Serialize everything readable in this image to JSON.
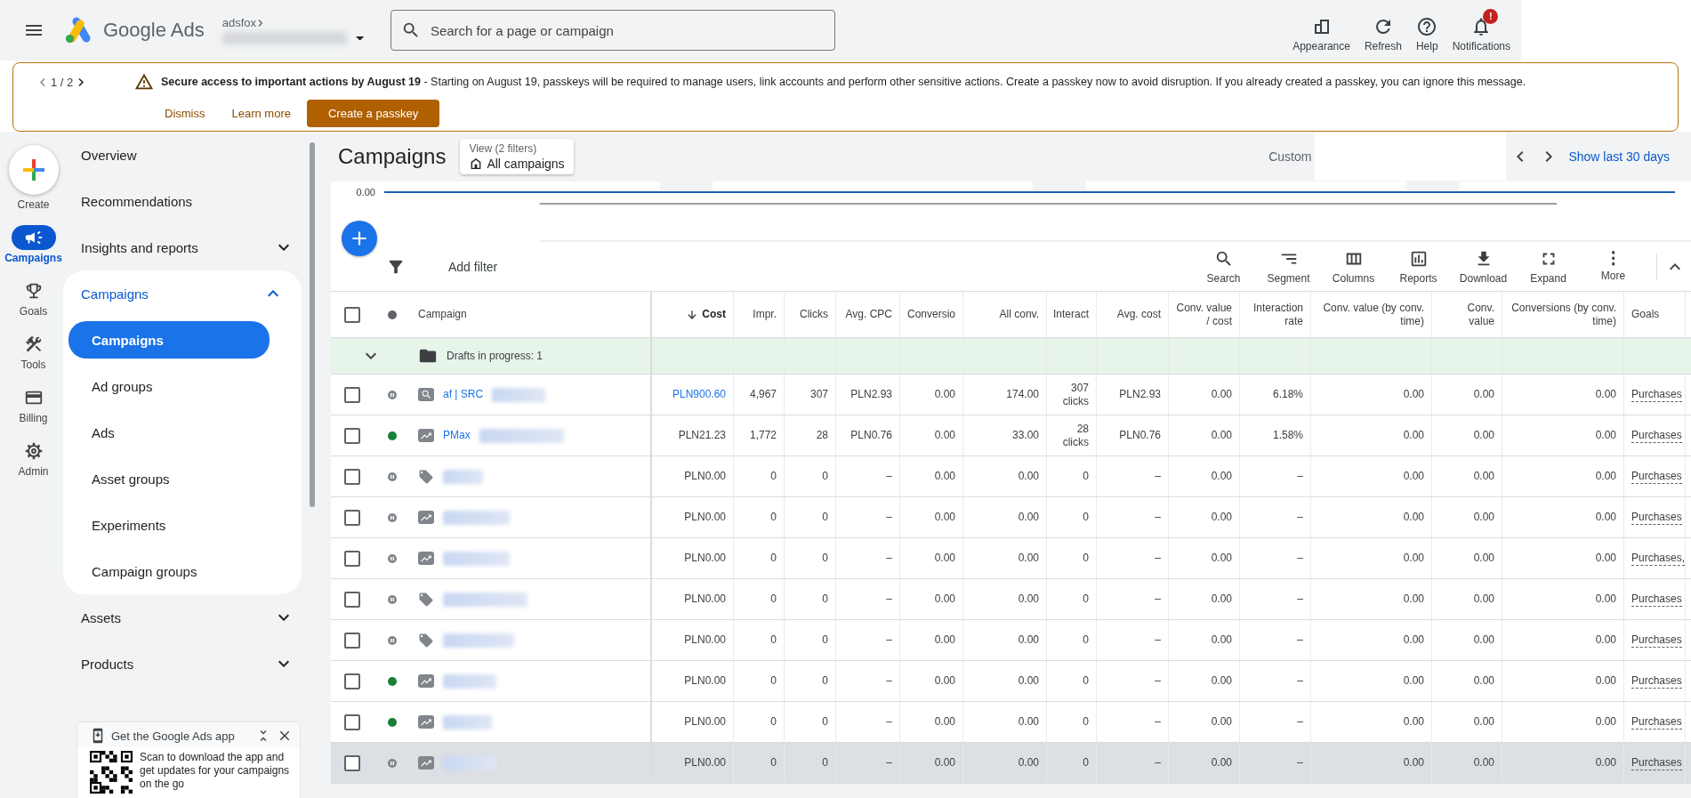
{
  "header": {
    "product": "Google Ads",
    "account": "adsfox",
    "search_placeholder": "Search for a page or campaign",
    "actions": [
      {
        "label": "Appearance",
        "kind": "appearance"
      },
      {
        "label": "Refresh",
        "kind": "refresh"
      },
      {
        "label": "Help",
        "kind": "help"
      },
      {
        "label": "Notifications",
        "kind": "notifications",
        "badge": "!"
      }
    ]
  },
  "banner": {
    "pager": "1 / 2",
    "message": "**Secure access to important actions by August 19** - Starting on August 19, passkeys will be required to manage users, link accounts and perform other sensitive actions. Create a passkey now to avoid disruption. If you already created a passkey, you can ignore this message.",
    "buttons": [
      {
        "label": "Dismiss",
        "kind": "text"
      },
      {
        "label": "Learn more",
        "kind": "text"
      },
      {
        "label": "Create a passkey",
        "kind": "primary"
      }
    ]
  },
  "rail": [
    {
      "label": "Create",
      "kind": "create",
      "selected": false
    },
    {
      "label": "Campaigns",
      "kind": "campaigns",
      "selected": true
    },
    {
      "label": "Goals",
      "kind": "goals",
      "selected": false
    },
    {
      "label": "Tools",
      "kind": "tools",
      "selected": false
    },
    {
      "label": "Billing",
      "kind": "billing",
      "selected": false
    },
    {
      "label": "Admin",
      "kind": "admin",
      "selected": false
    }
  ],
  "nav": [
    {
      "label": "Overview"
    },
    {
      "label": "Recommendations"
    },
    {
      "label": "Insights and reports",
      "expanded": false
    },
    {
      "label": "Campaigns",
      "expanded": true,
      "children": [
        {
          "label": "Campaigns",
          "selected": true
        },
        {
          "label": "Ad groups",
          "selected": false
        },
        {
          "label": "Ads",
          "selected": false
        },
        {
          "label": "Asset groups",
          "selected": false
        },
        {
          "label": "Experiments",
          "selected": false
        },
        {
          "label": "Campaign groups",
          "selected": false
        }
      ]
    },
    {
      "label": "Assets",
      "expanded": false
    },
    {
      "label": "Products",
      "expanded": false
    }
  ],
  "app_promo": {
    "title": "Get the Google Ads app",
    "text": "Scan to download the app and get updates for your campaigns on the go"
  },
  "page": {
    "title": "Campaigns",
    "view_label": "View (2 filters)",
    "view_value": "All campaigns",
    "date_label": "Custom",
    "date_link": "Show last 30 days"
  },
  "chart": {
    "axis_label": "0.00"
  },
  "toolbar": {
    "filter_label": "Add filter",
    "tools": [
      {
        "label": "Search",
        "kind": "search"
      },
      {
        "label": "Segment",
        "kind": "segment"
      },
      {
        "label": "Columns",
        "kind": "columns"
      },
      {
        "label": "Reports",
        "kind": "reports"
      },
      {
        "label": "Download",
        "kind": "download"
      },
      {
        "label": "Expand",
        "kind": "expand"
      },
      {
        "label": "More",
        "kind": "more"
      }
    ]
  },
  "table": {
    "name_column": "Campaign",
    "all_checked": false,
    "columns": [
      {
        "label": "Cost",
        "kind": "metric",
        "sorted": true
      },
      {
        "label": "Impr.",
        "kind": "metric",
        "sorted": false
      },
      {
        "label": "Clicks",
        "kind": "metric",
        "sorted": false
      },
      {
        "label": "Avg. CPC",
        "kind": "metric",
        "sorted": false
      },
      {
        "label": "Conversio",
        "kind": "metric",
        "sorted": false
      },
      {
        "label": "All conv.",
        "kind": "metric",
        "sorted": false
      },
      {
        "label": "Interact",
        "kind": "metric",
        "sorted": false
      },
      {
        "label": "Avg. cost",
        "kind": "metric",
        "sorted": false
      },
      {
        "label": "Conv. value / cost",
        "kind": "metric",
        "sorted": false
      },
      {
        "label": "Interaction rate",
        "kind": "metric",
        "sorted": false
      },
      {
        "label": "Conv. value (by conv. time)",
        "kind": "metric",
        "sorted": false
      },
      {
        "label": "Conv. value",
        "kind": "metric",
        "sorted": false
      },
      {
        "label": "Conversions (by conv. time)",
        "kind": "metric",
        "sorted": false
      },
      {
        "label": "Goals",
        "kind": "goal",
        "sorted": false
      }
    ],
    "group_row": {
      "label": "Drafts in progress: 1",
      "expanded": false
    },
    "rows": [
      {
        "checked": false,
        "enabled": false,
        "kind": "search",
        "name": "af | SRC",
        "cost_linked": true,
        "highlighted": false,
        "cells": [
          "PLN900.60",
          "4,967",
          "307",
          "PLN2.93",
          "0.00",
          "174.00",
          "307 clicks",
          "PLN2.93",
          "0.00",
          "6.18%",
          "0.00",
          "0.00",
          "0.00",
          "Purchases"
        ]
      },
      {
        "checked": false,
        "enabled": true,
        "kind": "pmax",
        "name": "PMax",
        "cost_linked": false,
        "highlighted": false,
        "cells": [
          "PLN21.23",
          "1,772",
          "28",
          "PLN0.76",
          "0.00",
          "33.00",
          "28 clicks",
          "PLN0.76",
          "0.00",
          "1.58%",
          "0.00",
          "0.00",
          "0.00",
          "Purchases"
        ]
      },
      {
        "checked": false,
        "enabled": false,
        "kind": "shopping",
        "cost_linked": false,
        "highlighted": false,
        "cells": [
          "PLN0.00",
          "0",
          "0",
          "–",
          "0.00",
          "0.00",
          "0",
          "–",
          "0.00",
          "–",
          "0.00",
          "0.00",
          "0.00",
          "Purchases"
        ]
      },
      {
        "checked": false,
        "enabled": false,
        "kind": "pmax",
        "cost_linked": false,
        "highlighted": false,
        "cells": [
          "PLN0.00",
          "0",
          "0",
          "–",
          "0.00",
          "0.00",
          "0",
          "–",
          "0.00",
          "–",
          "0.00",
          "0.00",
          "0.00",
          "Purchases"
        ]
      },
      {
        "checked": false,
        "enabled": false,
        "kind": "pmax",
        "cost_linked": false,
        "highlighted": false,
        "cells": [
          "PLN0.00",
          "0",
          "0",
          "–",
          "0.00",
          "0.00",
          "0",
          "–",
          "0.00",
          "–",
          "0.00",
          "0.00",
          "0.00",
          "Purchases,"
        ]
      },
      {
        "checked": false,
        "enabled": false,
        "kind": "shopping",
        "cost_linked": false,
        "highlighted": false,
        "cells": [
          "PLN0.00",
          "0",
          "0",
          "–",
          "0.00",
          "0.00",
          "0",
          "–",
          "0.00",
          "–",
          "0.00",
          "0.00",
          "0.00",
          "Purchases"
        ]
      },
      {
        "checked": false,
        "enabled": false,
        "kind": "shopping",
        "cost_linked": false,
        "highlighted": false,
        "cells": [
          "PLN0.00",
          "0",
          "0",
          "–",
          "0.00",
          "0.00",
          "0",
          "–",
          "0.00",
          "–",
          "0.00",
          "0.00",
          "0.00",
          "Purchases"
        ]
      },
      {
        "checked": false,
        "enabled": true,
        "kind": "pmax",
        "cost_linked": false,
        "highlighted": false,
        "cells": [
          "PLN0.00",
          "0",
          "0",
          "–",
          "0.00",
          "0.00",
          "0",
          "–",
          "0.00",
          "–",
          "0.00",
          "0.00",
          "0.00",
          "Purchases"
        ]
      },
      {
        "checked": false,
        "enabled": true,
        "kind": "pmax",
        "cost_linked": false,
        "highlighted": false,
        "cells": [
          "PLN0.00",
          "0",
          "0",
          "–",
          "0.00",
          "0.00",
          "0",
          "–",
          "0.00",
          "–",
          "0.00",
          "0.00",
          "0.00",
          "Purchases"
        ]
      },
      {
        "checked": false,
        "enabled": false,
        "kind": "pmax",
        "cost_linked": false,
        "highlighted": true,
        "cells": [
          "PLN0.00",
          "0",
          "0",
          "–",
          "0.00",
          "0.00",
          "0",
          "–",
          "0.00",
          "–",
          "0.00",
          "0.00",
          "0.00",
          "Purchases"
        ]
      }
    ]
  }
}
